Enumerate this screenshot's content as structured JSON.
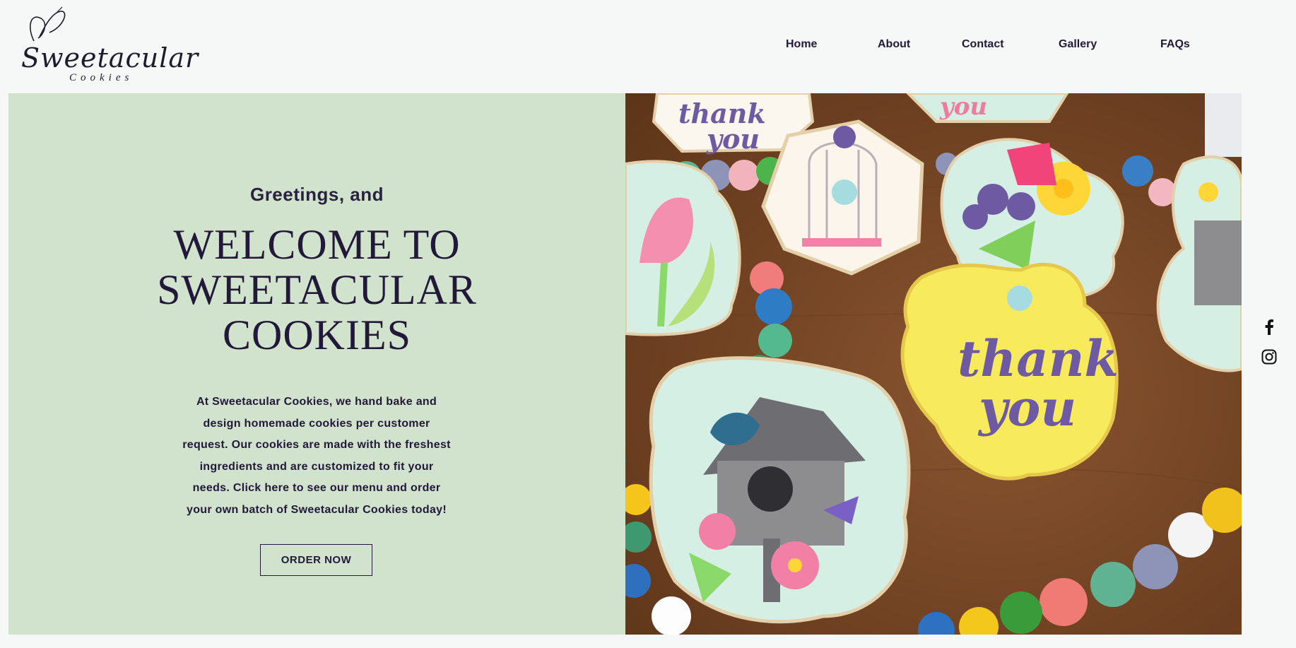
{
  "brand": {
    "name": "Sweetacular",
    "sub": "Cookies"
  },
  "nav": {
    "items": [
      "Home",
      "About",
      "Contact",
      "Gallery",
      "FAQs"
    ]
  },
  "hero": {
    "greeting": "Greetings, and",
    "title_lines": [
      "WELCOME TO",
      "SWEETACULAR",
      "COOKIES"
    ],
    "intro_lines": [
      "At Sweetacular Cookies, we hand bake and",
      "design homemade cookies per customer",
      "request. Our cookies are made with the freshest",
      "ingredients and are customized to fit your",
      "needs. Click here to see our menu and order",
      "your own batch of Sweetacular Cookies today!"
    ],
    "cta": "ORDER NOW",
    "image_text": {
      "ty_a": "thank",
      "ty_b": "you"
    }
  },
  "social": {
    "icons": [
      "facebook-icon",
      "instagram-icon"
    ]
  },
  "colors": {
    "panel": "#d1e2cd",
    "ink": "#22193a",
    "page": "#f6f7f7"
  }
}
